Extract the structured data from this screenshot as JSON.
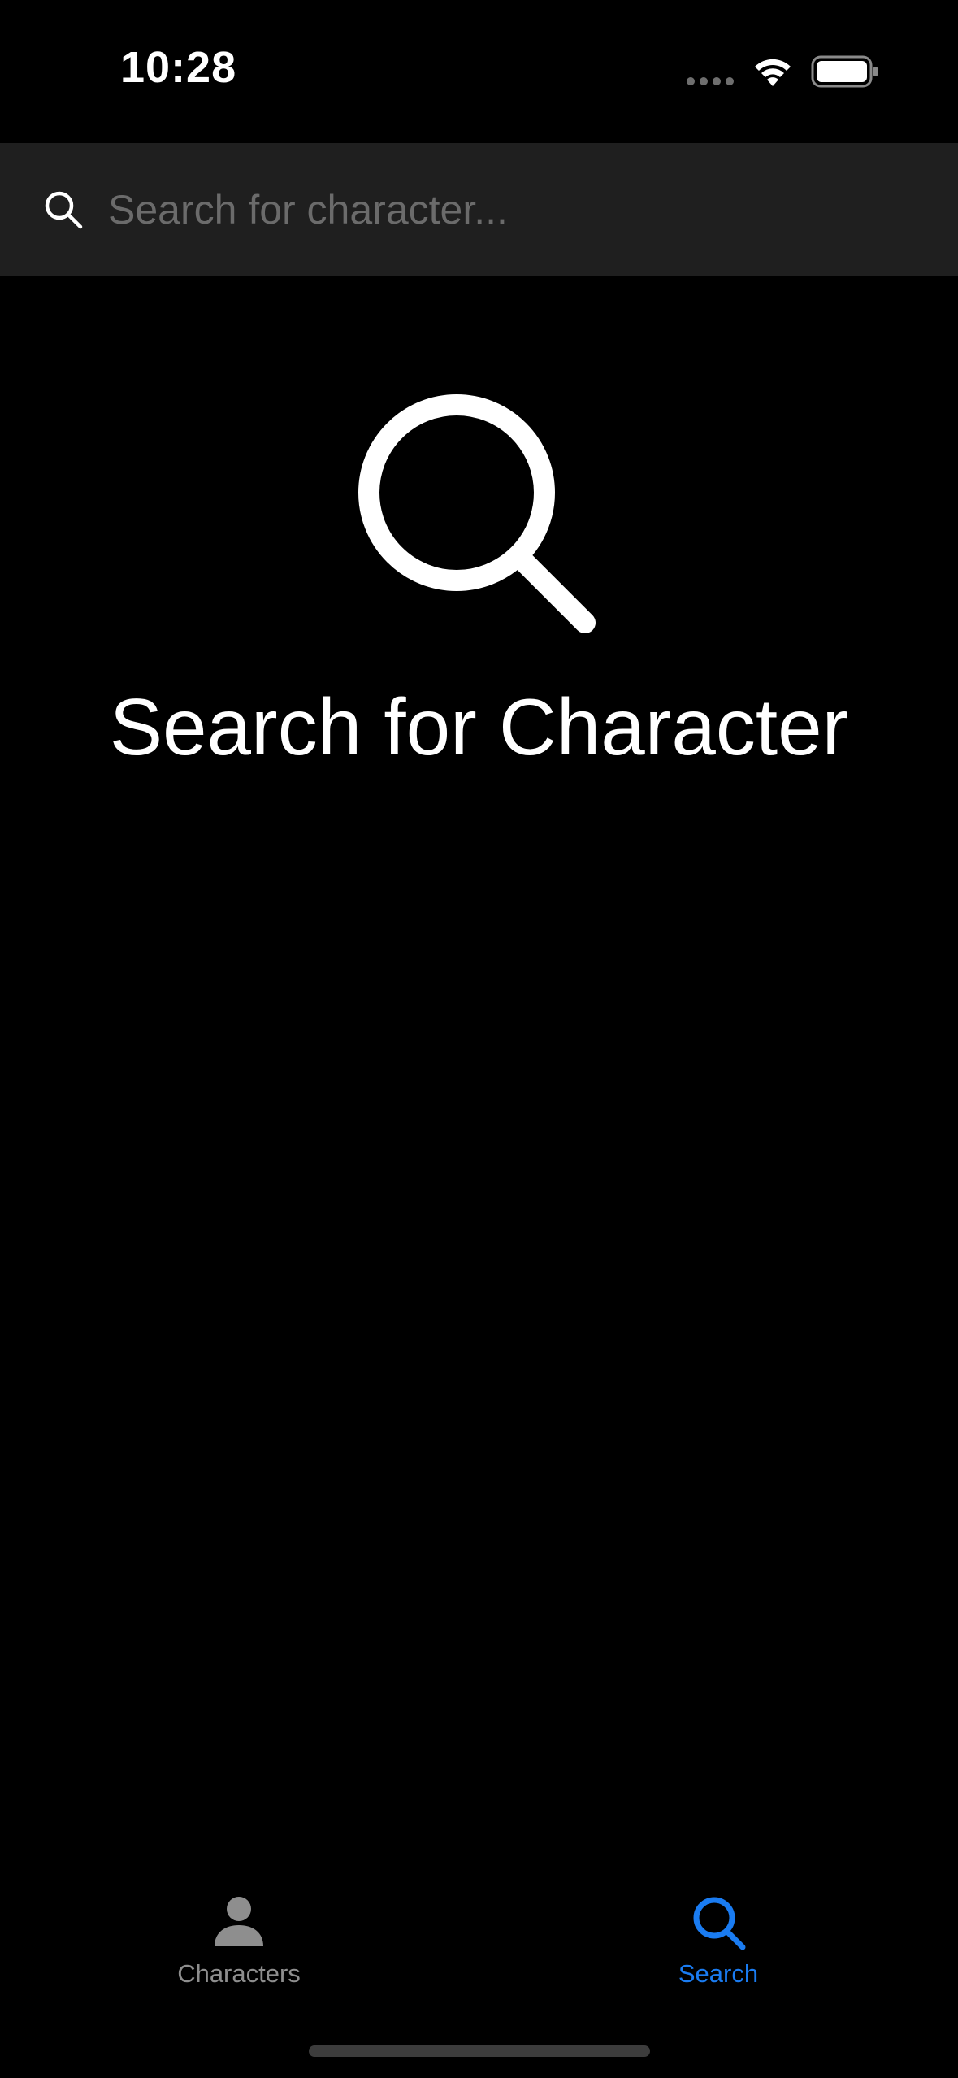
{
  "status_bar": {
    "time": "10:28",
    "icons": [
      "signal-icon",
      "wifi-icon",
      "battery-icon"
    ]
  },
  "search": {
    "placeholder": "Search for character...",
    "value": "",
    "icon": "search-icon"
  },
  "empty_state": {
    "icon": "magnifying-glass-icon",
    "title": "Search for Character"
  },
  "tab_bar": {
    "items": [
      {
        "label": "Characters",
        "icon": "person-icon",
        "selected": false
      },
      {
        "label": "Search",
        "icon": "search-icon",
        "selected": true
      }
    ]
  },
  "colors": {
    "background": "#000000",
    "search_bar_bg": "#1f1f1f",
    "placeholder": "#6b6b6b",
    "accent": "#1a7cf2",
    "inactive_tab": "#8e8e8e"
  }
}
